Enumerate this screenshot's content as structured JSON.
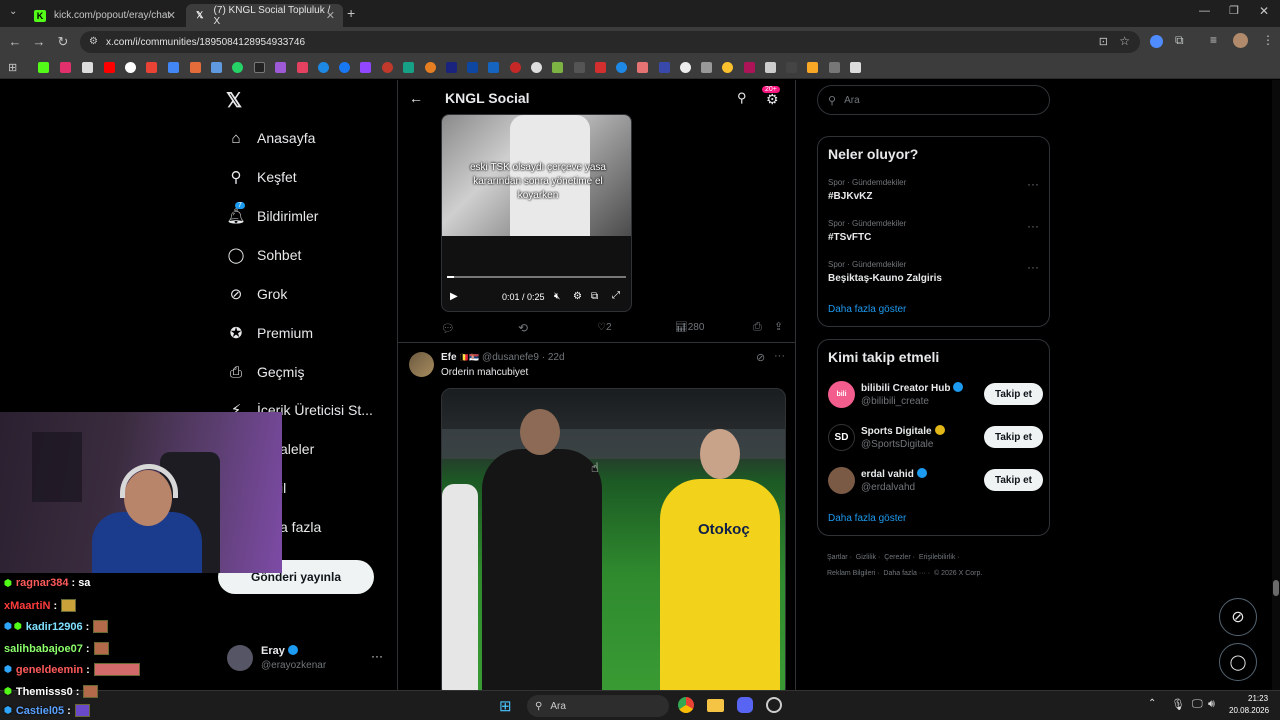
{
  "browser": {
    "tabs": [
      {
        "title": "kick.com/popout/eray/chat",
        "active": false
      },
      {
        "title": "(7) KNGL Social Topluluk / X",
        "active": true
      }
    ],
    "url": "x.com/i/communities/1895084128954933746"
  },
  "sidebar": {
    "items": [
      {
        "label": "Anasayfa",
        "icon": "home-icon"
      },
      {
        "label": "Keşfet",
        "icon": "search-icon"
      },
      {
        "label": "Bildirimler",
        "icon": "bell-icon",
        "badge": "7"
      },
      {
        "label": "Sohbet",
        "icon": "chat-icon"
      },
      {
        "label": "Grok",
        "icon": "grok-icon"
      },
      {
        "label": "Premium",
        "icon": "premium-icon"
      },
      {
        "label": "Geçmiş",
        "icon": "bookmark-icon"
      },
      {
        "label": "İçerik Üreticisi St...",
        "icon": "lightning-icon"
      },
      {
        "label": "aleler",
        "icon": "article-icon"
      },
      {
        "label": "il",
        "icon": "profile-icon"
      },
      {
        "label": "a fazla",
        "icon": "more-icon"
      }
    ],
    "post_button": "Gönderi yayınla",
    "account": {
      "name": "Eray",
      "handle": "@erayozkenar"
    }
  },
  "community": {
    "title": "KNGL Social",
    "notif_badge": "20+"
  },
  "post1": {
    "caption_overlay": "eski TSK olsaydı çerçeve yasa kararından sonra yönetime el koyarken",
    "video_time": "0:01 / 0:25",
    "video_progress": 0.04,
    "likes": "2",
    "views": "280"
  },
  "post2": {
    "name": "Efe",
    "flags": "🇧🇪🇷🇸",
    "handle": "@dusanefe9",
    "time": "22d",
    "text": "Orderin mahcubiyet",
    "video_jersey_text": "Otokoç"
  },
  "search": {
    "placeholder": "Ara"
  },
  "trends": {
    "title": "Neler oluyor?",
    "items": [
      {
        "category": "Spor · Gündemdekiler",
        "name": "#BJKvKZ"
      },
      {
        "category": "Spor · Gündemdekiler",
        "name": "#TSvFTC"
      },
      {
        "category": "Spor · Gündemdekiler",
        "name": "Beşiktaş-Kauno Zalgiris"
      }
    ],
    "more": "Daha fazla göster"
  },
  "who_to_follow": {
    "title": "Kimi takip etmeli",
    "items": [
      {
        "name": "bilibili Creator Hub",
        "handle": "@bilibili_create",
        "badge": "blue",
        "avatar_color": "#f25d8e",
        "avatar_text": "bili"
      },
      {
        "name": "Sports Digitale",
        "handle": "@SportsDigitale",
        "badge": "gold",
        "avatar_color": "#000000",
        "avatar_text": "SD"
      },
      {
        "name": "erdal vahid",
        "handle": "@erdalvahd",
        "badge": "blue",
        "avatar_color": "#7a5a45",
        "avatar_text": ""
      }
    ],
    "follow_label": "Takip et",
    "more": "Daha fazla göster"
  },
  "footer": {
    "links": [
      "Şartlar",
      "Gizlilik",
      "Çerezler",
      "Erişilebilirlik",
      "Reklam Bilgileri",
      "Daha fazla ···",
      "© 2026 X Corp."
    ]
  },
  "stream_chat": [
    {
      "user": "ragnar384",
      "message": "sa",
      "color": "#ff5a5a"
    },
    {
      "user": "xMaartiN",
      "message": "",
      "color": "#ff3c3c",
      "emote": true
    },
    {
      "user": "kadir12906",
      "message": "",
      "color": "#7fe0ff",
      "emote": true
    },
    {
      "user": "salihbabajoe07",
      "message": "",
      "color": "#8cff6b",
      "emote": true
    },
    {
      "user": "geneldeemin",
      "message": "",
      "color": "#ff5a5a",
      "emote": true
    },
    {
      "user": "Themisss0",
      "message": "",
      "color": "#ffffff",
      "emote": true
    },
    {
      "user": "Castiel05",
      "message": "",
      "color": "#5aa0ff",
      "emote": true
    }
  ],
  "taskbar": {
    "search_placeholder": "Ara",
    "time": "21:23",
    "date": "20.08.2026"
  },
  "colors": {
    "accent": "#1d9bf0",
    "brand_pink": "#f91880"
  }
}
